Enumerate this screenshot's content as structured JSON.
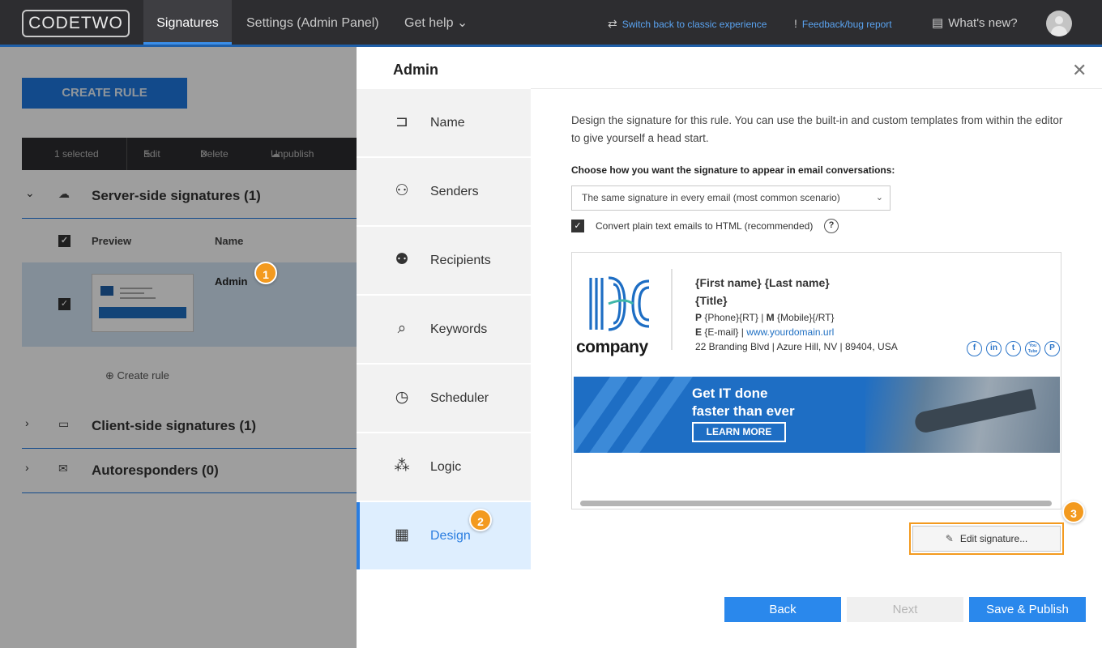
{
  "topbar": {
    "logo": "CODETWO",
    "tabs": [
      {
        "label": "Signatures",
        "active": true
      },
      {
        "label": "Settings (Admin Panel)"
      },
      {
        "label": "Get help ⌄"
      }
    ],
    "switch_link": "Switch back to classic experience",
    "feedback_link": "Feedback/bug report",
    "whats_new": "What's new?"
  },
  "background": {
    "create_rule": "CREATE RULE",
    "selection": {
      "count": "1 selected",
      "edit": "Edit",
      "delete": "Delete",
      "unpublish": "Unpublish"
    },
    "groups": [
      {
        "title": "Server-side signatures (1)",
        "icon": "cloud-icon"
      },
      {
        "title": "Client-side signatures (1)",
        "icon": "monitor-icon"
      },
      {
        "title": "Autoresponders (0)",
        "icon": "mail-reply-icon"
      }
    ],
    "columns": {
      "preview": "Preview",
      "name": "Name"
    },
    "rule_name": "Admin",
    "create_rule_link": "Create rule"
  },
  "badges": {
    "one": "1",
    "two": "2",
    "three": "3"
  },
  "panel": {
    "title": "Admin",
    "steps": [
      {
        "label": "Name",
        "icon": "signpost-icon"
      },
      {
        "label": "Senders",
        "icon": "senders-icon"
      },
      {
        "label": "Recipients",
        "icon": "recipients-icon"
      },
      {
        "label": "Keywords",
        "icon": "keywords-icon"
      },
      {
        "label": "Scheduler",
        "icon": "clock-icon"
      },
      {
        "label": "Logic",
        "icon": "logic-icon"
      },
      {
        "label": "Design",
        "icon": "design-icon",
        "active": true
      }
    ],
    "intro": "Design the signature for this rule. You can use the built-in and custom templates from within the editor to give yourself a head start.",
    "choose_label": "Choose how you want the signature to appear in email conversations:",
    "select_value": "The same signature in every email (most common scenario)",
    "convert_label": "Convert plain text emails to HTML (recommended)",
    "convert_checked": true,
    "signature": {
      "company": "company",
      "name": "{First name} {Last name}",
      "title": "{Title}",
      "phone_label": "P",
      "phone_value": "{Phone}{RT}",
      "mobile_label": "M",
      "mobile_value": "{Mobile}{/RT}",
      "email_label": "E",
      "email_value": "{E-mail}",
      "website": "www.yourdomain.url",
      "address": "22 Branding Blvd | Azure Hill, NV | 89404, USA",
      "social": [
        "f",
        "in",
        "t",
        "You Tube",
        "P"
      ],
      "banner_headline_1": "Get IT done",
      "banner_headline_2": "faster than ever",
      "banner_cta": "LEARN MORE"
    },
    "edit_signature": "Edit signature...",
    "footer": {
      "back": "Back",
      "next": "Next",
      "save": "Save & Publish"
    }
  },
  "colors": {
    "accent": "#2a88ec",
    "badge": "#f39a1f",
    "topbar": "#2d2d30"
  }
}
